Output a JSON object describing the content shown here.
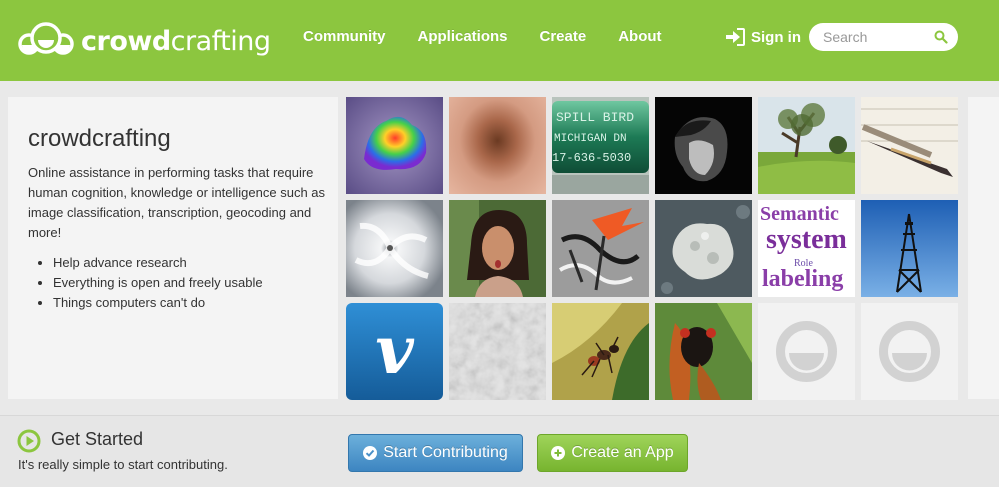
{
  "brand": {
    "name_bold": "crowd",
    "name_rest": "crafting",
    "logo_icon": "crowdcrafting-logo-icon"
  },
  "nav": {
    "links": [
      "Community",
      "Applications",
      "Create",
      "About"
    ],
    "signin": {
      "label": "Sign in",
      "icon": "sign-in-icon"
    },
    "search": {
      "placeholder": "Search",
      "icon": "search-icon"
    }
  },
  "hero": {
    "title": "crowdcrafting",
    "description": "Online assistance in performing tasks that require human cognition, knowledge or intelligence such as image classification, transcription, geocoding and more!",
    "bullets": [
      "Help advance research",
      "Everything is open and freely usable",
      "Things computers can't do"
    ]
  },
  "grid": {
    "tiles": [
      {
        "kind": "rainbow-blob"
      },
      {
        "kind": "skin-mole"
      },
      {
        "kind": "bird-band"
      },
      {
        "kind": "portrait-bw"
      },
      {
        "kind": "park-tree"
      },
      {
        "kind": "fountain-pen"
      },
      {
        "kind": "hurricane"
      },
      {
        "kind": "woman-face"
      },
      {
        "kind": "graffiti"
      },
      {
        "kind": "lichen-rock"
      },
      {
        "kind": "semantic-wordcloud"
      },
      {
        "kind": "radio-tower"
      },
      {
        "kind": "vimeo-logo"
      },
      {
        "kind": "noise-texture"
      },
      {
        "kind": "ant-on-leaf"
      },
      {
        "kind": "cicada"
      },
      {
        "kind": "placeholder-face"
      },
      {
        "kind": "placeholder-face"
      }
    ],
    "wordcloud_words": [
      "Semantic",
      "system",
      "labeling",
      "Role"
    ],
    "band_text": [
      "SPILL BIRD",
      "MICHIGAN DN",
      "17-636-5030"
    ],
    "vimeo_letter": "v"
  },
  "footer": {
    "title": "Get Started",
    "subtitle": "It's really simple to start contributing.",
    "buttons": [
      {
        "label": "Start Contributing",
        "icon": "check-circle-icon",
        "color": "#4a90c8"
      },
      {
        "label": "Create an App",
        "icon": "plus-circle-icon",
        "color": "#86c43e"
      }
    ]
  },
  "colors": {
    "navbar": "#8cc63f",
    "background": "#e9e9e9",
    "panel": "#f4f4f4"
  }
}
